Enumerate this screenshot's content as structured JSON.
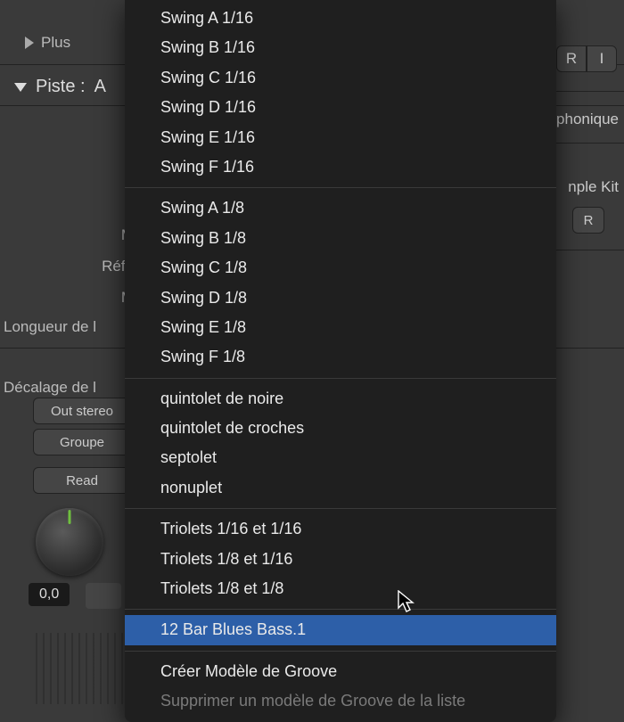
{
  "sidebar": {
    "plus": "Plus",
    "piste_label": "Piste :",
    "piste_value": "A",
    "param_m1": "M",
    "param_refo": "Réfo",
    "param_m2": "M",
    "param_longueur": "Longueur de l",
    "param_decalage": "Décalage de l",
    "btn_out": "Out stereo",
    "btn_groupe": "Groupe",
    "btn_read": "Read",
    "pan_value": "0,0"
  },
  "right": {
    "seg_r": "R",
    "seg_i": "I",
    "text_phonique": "phonique",
    "text_kit": "nple Kit",
    "btn_r": "R"
  },
  "menu": {
    "groups": [
      {
        "type": "items",
        "items": [
          "Swing A 1/16",
          "Swing B 1/16",
          "Swing C 1/16",
          "Swing D 1/16",
          "Swing E 1/16",
          "Swing F 1/16"
        ]
      },
      {
        "type": "divider"
      },
      {
        "type": "items",
        "items": [
          "Swing A 1/8",
          "Swing B 1/8",
          "Swing C 1/8",
          "Swing D 1/8",
          "Swing E 1/8",
          "Swing F 1/8"
        ]
      },
      {
        "type": "divider"
      },
      {
        "type": "items",
        "items": [
          "quintolet de noire",
          "quintolet de croches",
          "septolet",
          "nonuplet"
        ]
      },
      {
        "type": "divider"
      },
      {
        "type": "items",
        "items": [
          "Triolets 1/16 et 1/16",
          "Triolets 1/8 et 1/16",
          "Triolets 1/8 et 1/8"
        ]
      },
      {
        "type": "divider"
      },
      {
        "type": "items",
        "items": [
          "12 Bar Blues Bass.1"
        ],
        "highlighted_index": 0
      },
      {
        "type": "divider"
      },
      {
        "type": "items",
        "items": [
          "Créer Modèle de Groove"
        ]
      },
      {
        "type": "items",
        "items": [
          "Supprimer un modèle de Groove de la liste"
        ],
        "disabled": true
      }
    ]
  }
}
